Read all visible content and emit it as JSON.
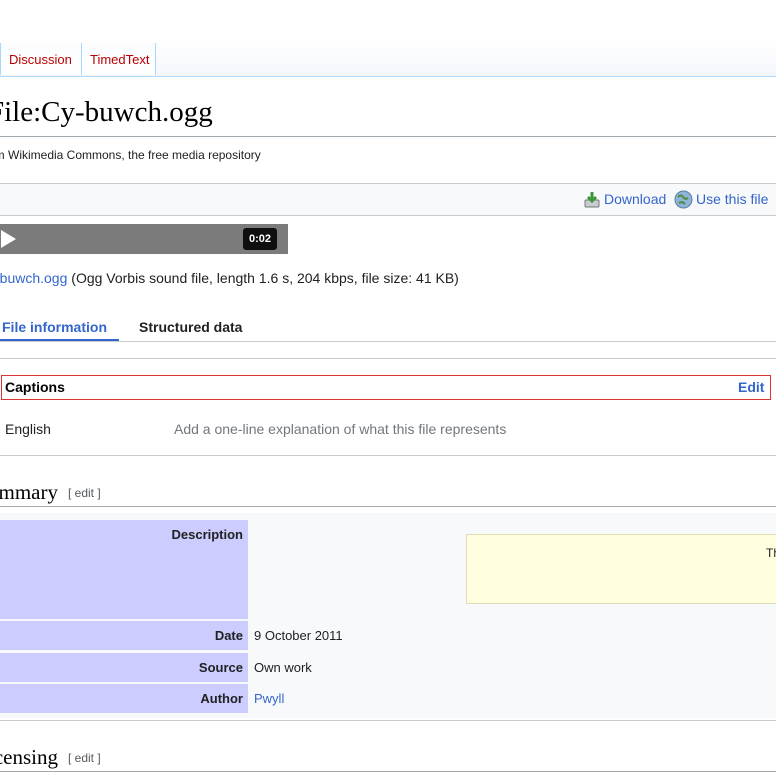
{
  "tabs": [
    "Discussion",
    "TimedText"
  ],
  "page_title": "File:Cy-buwch.ogg",
  "from_line": "om Wikimedia Commons, the free media repository",
  "toolbar": {
    "download": "Download",
    "use": "Use this file"
  },
  "player": {
    "time": "0:02"
  },
  "file_line": {
    "link": "y-buwch.ogg",
    "info": " (Ogg Vorbis sound file, length 1.6 s, 204 kbps, file size: 41 KB)"
  },
  "subtabs": {
    "file_info": "File information",
    "structured": "Structured data"
  },
  "captions": {
    "title": "Captions",
    "edit": "Edit",
    "language": "English",
    "placeholder": "Add a one-line explanation of what this file represents"
  },
  "summary": {
    "heading": "ummary",
    "edit_label": "[ edit ]",
    "rows": {
      "description_label": "Description",
      "description_box_text": "Th",
      "date_label": "Date",
      "date_value": "9 October 2011",
      "source_label": "Source",
      "source_value": "Own work",
      "author_label": "Author",
      "author_value": "Pwyll"
    }
  },
  "licensing": {
    "heading": "icensing",
    "edit_label": "[ edit ]"
  },
  "colors": {
    "link": "#3366cc",
    "tab_link": "#ba0000",
    "table_header": "#ccccff",
    "captions_border": "#dd3333"
  }
}
